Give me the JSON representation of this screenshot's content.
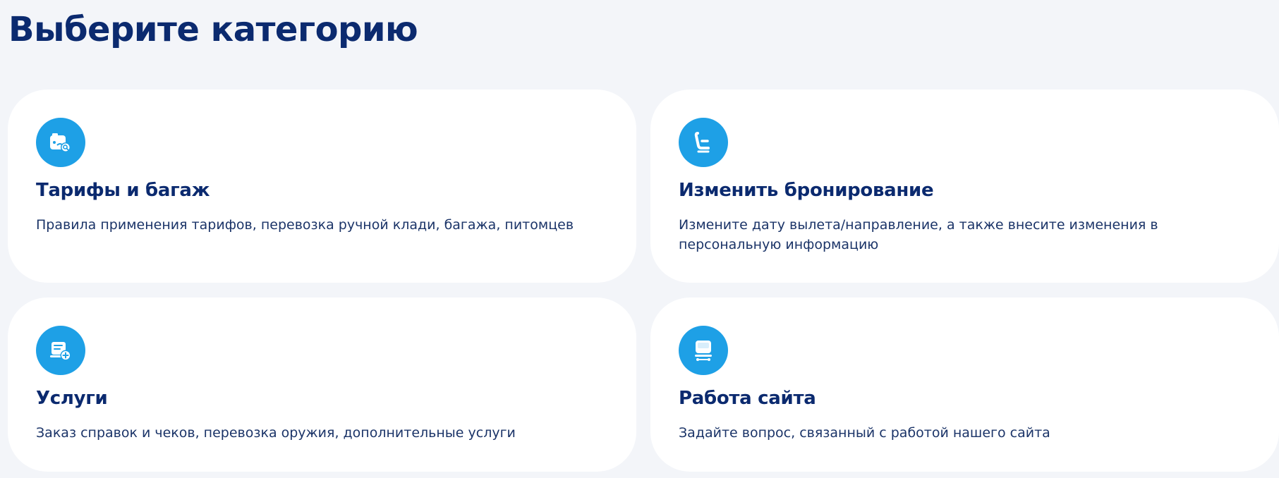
{
  "page": {
    "title": "Выберите категорию"
  },
  "categories": [
    {
      "title": "Тарифы и багаж",
      "description": "Правила применения тарифов, перевозка ручной клади, багажа, питомцев",
      "icon": "luggage-search-icon"
    },
    {
      "title": "Изменить бронирование",
      "description": "Измените дату вылета/направление, а также внесите изменения в персональную информацию",
      "icon": "seat-icon"
    },
    {
      "title": "Услуги",
      "description": "Заказ справок и чеков, перевозка оружия, дополнительные услуги",
      "icon": "document-add-icon"
    },
    {
      "title": "Работа сайта",
      "description": "Задайте вопрос, связанный с работой нашего сайта",
      "icon": "monitor-icon"
    }
  ],
  "colors": {
    "background": "#f3f5f9",
    "card": "#ffffff",
    "accent": "#1ea0e6",
    "heading": "#0b2a6f",
    "text": "#1b3468"
  }
}
